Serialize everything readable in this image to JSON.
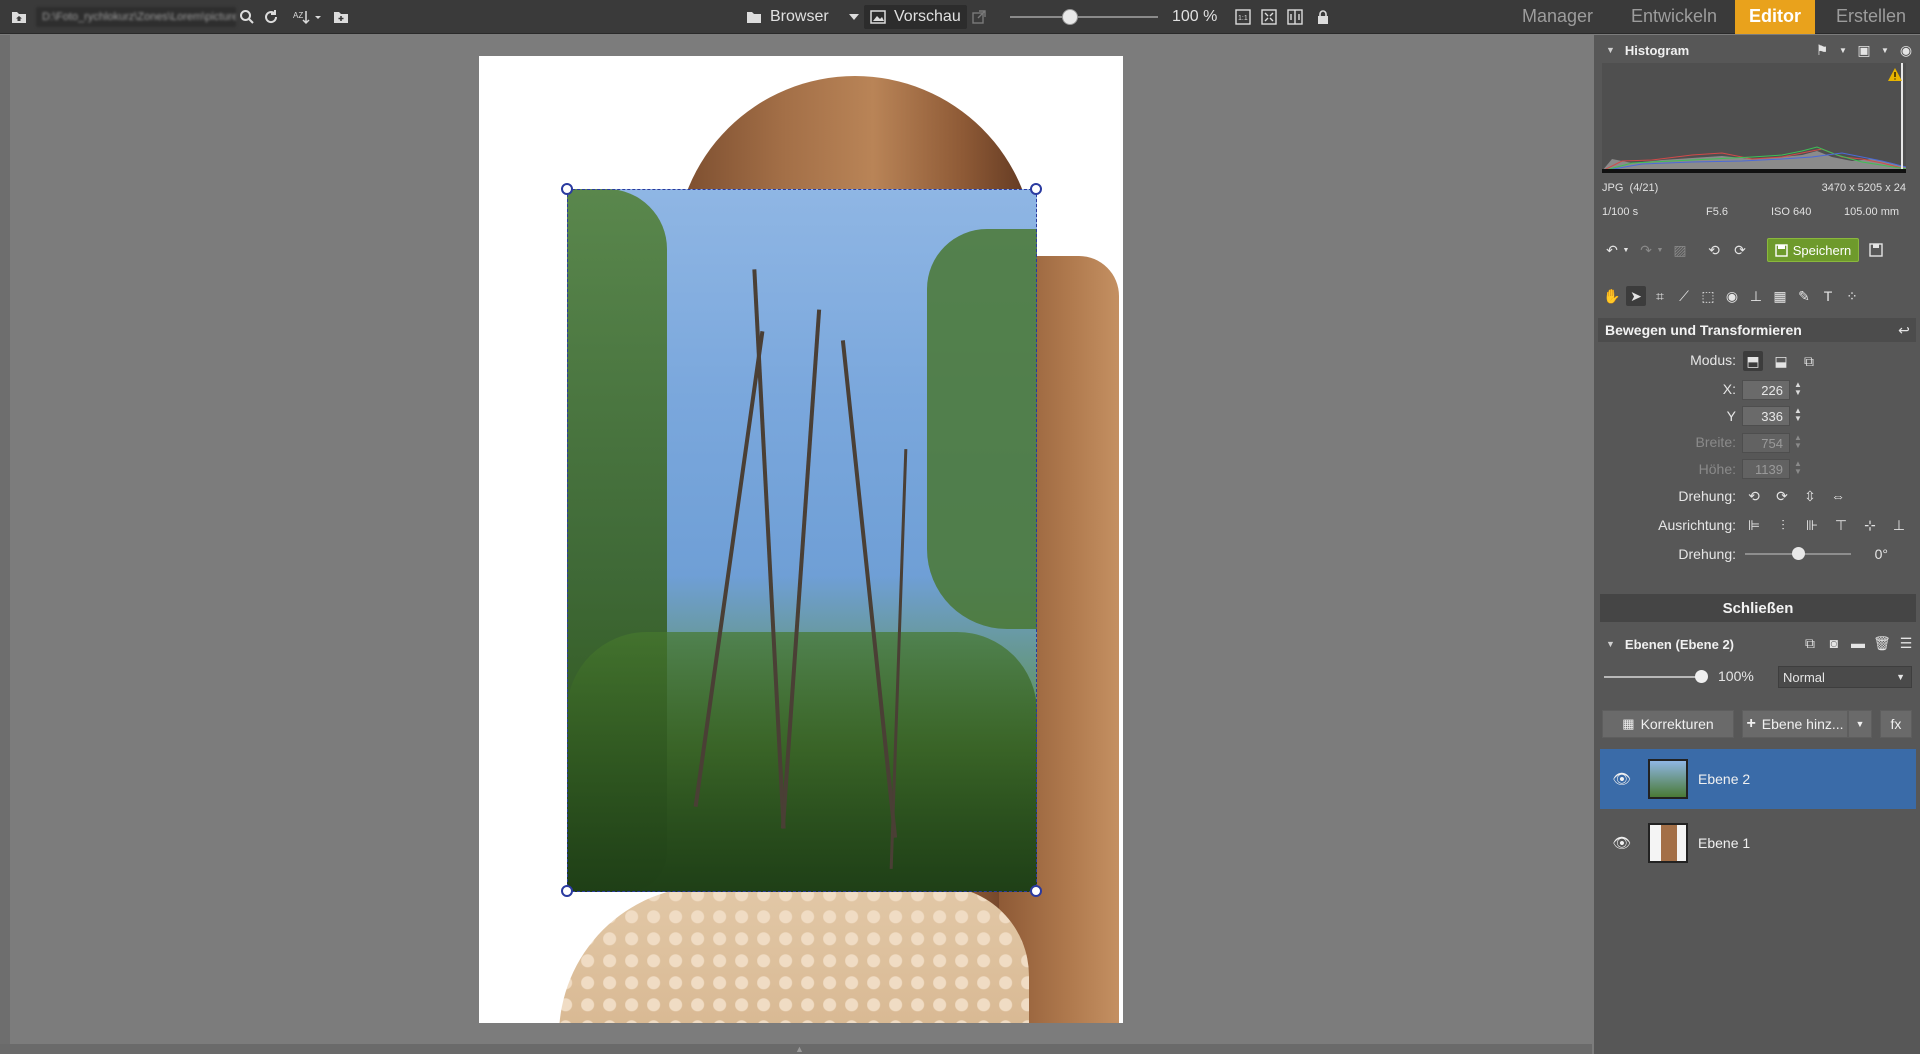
{
  "topbar": {
    "path_text": "D:\\Foto_rychlokurz\\Zones\\Lorem\\pictures",
    "browser_label": "Browser",
    "preview_label": "Vorschau",
    "zoom_value": "100 %",
    "tabs": [
      {
        "label": "Manager"
      },
      {
        "label": "Entwickeln"
      },
      {
        "label": "Editor"
      },
      {
        "label": "Erstellen"
      }
    ],
    "active_tab": "Editor"
  },
  "histogram": {
    "title": "Histogram",
    "format": "JPG",
    "index": "(4/21)",
    "dimensions": "3470 x 5205 x 24",
    "shutter": "1/100 s",
    "aperture": "F5.6",
    "iso": "ISO 640",
    "focal": "105.00 mm",
    "warning_color": "#e8b500"
  },
  "toolbar": {
    "save_label": "Speichern"
  },
  "transform": {
    "title": "Bewegen und Transformieren",
    "mode_label": "Modus:",
    "x_label": "X:",
    "x_value": "226",
    "y_label": "Y",
    "y_value": "336",
    "width_label": "Breite:",
    "width_value": "754",
    "height_label": "Höhe:",
    "height_value": "1139",
    "rotation_label": "Drehung:",
    "alignment_label": "Ausrichtung:",
    "rotation_slider_label": "Drehung:",
    "rotation_value": "0°",
    "close_label": "Schließen"
  },
  "layers": {
    "title": "Ebenen (Ebene 2)",
    "opacity": "100%",
    "opacity_fraction": 1.0,
    "blend_mode": "Normal",
    "corrections_label": "Korrekturen",
    "add_layer_label": "Ebene hinz...",
    "fx_label": "fx",
    "items": [
      {
        "name": "Ebene 2",
        "selected": true
      },
      {
        "name": "Ebene 1",
        "selected": false
      }
    ]
  },
  "colors": {
    "accent": "#e9a21c",
    "selection": "#3a6ba8",
    "save_green": "#6e9a2c"
  }
}
